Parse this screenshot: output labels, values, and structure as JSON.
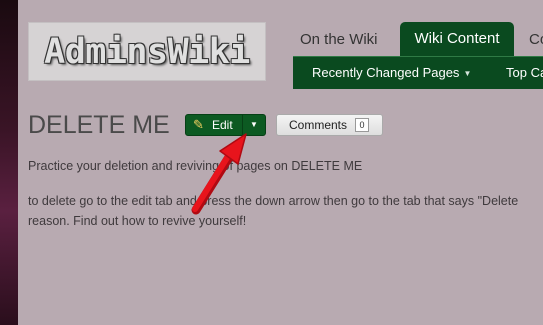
{
  "site": {
    "logo_text": "AdminsWiki"
  },
  "nav": {
    "tabs": [
      {
        "label": "On the Wiki"
      },
      {
        "label": "Wiki Content"
      },
      {
        "label": "Co"
      }
    ],
    "subnav": [
      {
        "label": "Recently Changed Pages"
      },
      {
        "label": "Top Ca"
      }
    ]
  },
  "article": {
    "title": "DELETE ME",
    "edit_label": "Edit",
    "comments_label": "Comments",
    "comments_count": "0",
    "paragraphs": [
      "Practice your deletion and reviving of pages on DELETE ME",
      "to delete go to the edit tab and press the down arrow then go to the tab that says \"Delete",
      "reason. Find out how to revive yourself!"
    ]
  },
  "colors": {
    "nav_green": "#0a4a1f",
    "button_green": "#0c5a22",
    "page_bg": "#b8aab1",
    "annotation_arrow": "#e8141c"
  },
  "icons": [
    "pencil-icon",
    "dropdown-caret-icon",
    "annotation-arrow"
  ]
}
